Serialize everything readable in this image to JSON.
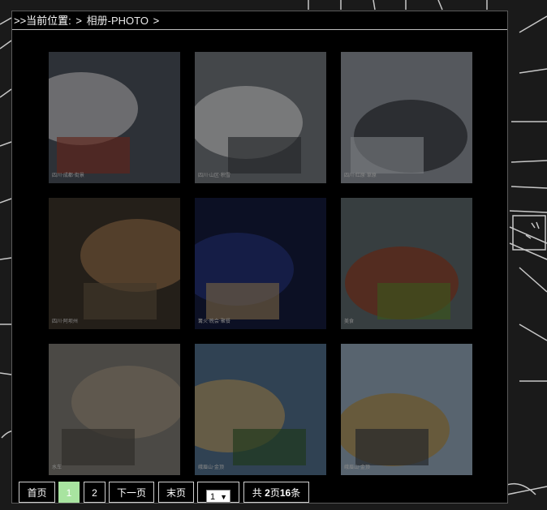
{
  "breadcrumb": {
    "prefix": ">>当前位置:",
    "separator": ">",
    "section": "相册-PHOTO",
    "trailing": ">"
  },
  "photos": [
    {
      "name": "photo-1",
      "caption": "四川·成都·街景",
      "colors": [
        "#4a4f5a",
        "#d9d9d9",
        "#9b3a2a"
      ]
    },
    {
      "name": "photo-2",
      "caption": "四川·山区·积雪",
      "colors": [
        "#6f7378",
        "#e6e6e6",
        "#3a3d42"
      ]
    },
    {
      "name": "photo-3",
      "caption": "四川·红原·草原",
      "colors": [
        "#8a8f97",
        "#2b2d33",
        "#c0c4cb"
      ]
    },
    {
      "name": "photo-4",
      "caption": "四川·阿坝州",
      "colors": [
        "#3b3229",
        "#a67c52",
        "#6b5b45"
      ]
    },
    {
      "name": "photo-5",
      "caption": "篝火·晚会·聚餐",
      "colors": [
        "#141a3a",
        "#2a3b8a",
        "#b89a6a"
      ]
    },
    {
      "name": "photo-6",
      "caption": "美食",
      "colors": [
        "#5a6468",
        "#9a3b1e",
        "#5f8a2e"
      ]
    },
    {
      "name": "photo-7",
      "caption": "水车",
      "colors": [
        "#7a7770",
        "#a89a86",
        "#4b4740"
      ]
    },
    {
      "name": "photo-8",
      "caption": "峨眉山·金顶",
      "colors": [
        "#4e6b86",
        "#c7a66a",
        "#2f5a2a"
      ]
    },
    {
      "name": "photo-9",
      "caption": "峨眉山·金顶",
      "colors": [
        "#8fa2b3",
        "#b08a3e",
        "#343a40"
      ]
    }
  ],
  "pager": {
    "first": "首页",
    "pages": [
      "1",
      "2"
    ],
    "current_page": "1",
    "next": "下一页",
    "last": "末页",
    "select_value": "1",
    "total_prefix": "共 ",
    "total_pages": "2",
    "total_mid": "页",
    "total_items": "16",
    "total_suffix": "条"
  }
}
